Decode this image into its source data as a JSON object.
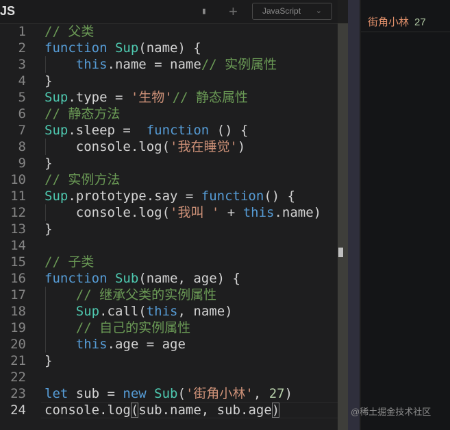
{
  "header": {
    "title": "JS",
    "language": "JavaScript"
  },
  "console": {
    "output_text": "街角小林",
    "output_number": "27"
  },
  "watermark": "@稀土掘金技术社区",
  "current_line": 24,
  "colors": {
    "keyword": "#569cd6",
    "class": "#4ec9b0",
    "string": "#ce9178",
    "comment": "#6a9955",
    "number": "#b5cea8"
  },
  "code": [
    [
      [
        "cm",
        "// 父类"
      ]
    ],
    [
      [
        "kw",
        "function "
      ],
      [
        "cl",
        "Sup"
      ],
      [
        "pl",
        "(name) {"
      ]
    ],
    [
      [
        "pl",
        "    "
      ],
      [
        "kw",
        "this"
      ],
      [
        "pl",
        ".name = name"
      ],
      [
        "cm",
        "// 实例属性"
      ]
    ],
    [
      [
        "pl",
        "}"
      ]
    ],
    [
      [
        "cl",
        "Sup"
      ],
      [
        "pl",
        ".type = "
      ],
      [
        "st",
        "'生物'"
      ],
      [
        "cm",
        "// 静态属性"
      ]
    ],
    [
      [
        "cm",
        "// 静态方法"
      ]
    ],
    [
      [
        "cl",
        "Sup"
      ],
      [
        "pl",
        ".sleep =  "
      ],
      [
        "kw",
        "function"
      ],
      [
        "pl",
        " () {"
      ]
    ],
    [
      [
        "pl",
        "    console.log("
      ],
      [
        "st",
        "'我在睡觉'"
      ],
      [
        "pl",
        ")"
      ]
    ],
    [
      [
        "pl",
        "}"
      ]
    ],
    [
      [
        "cm",
        "// 实例方法"
      ]
    ],
    [
      [
        "cl",
        "Sup"
      ],
      [
        "pl",
        ".prototype.say = "
      ],
      [
        "kw",
        "function"
      ],
      [
        "pl",
        "() {"
      ]
    ],
    [
      [
        "pl",
        "    console.log("
      ],
      [
        "st",
        "'我叫 '"
      ],
      [
        "pl",
        " + "
      ],
      [
        "kw",
        "this"
      ],
      [
        "pl",
        ".name)"
      ]
    ],
    [
      [
        "pl",
        "}"
      ]
    ],
    [],
    [
      [
        "cm",
        "// 子类"
      ]
    ],
    [
      [
        "kw",
        "function "
      ],
      [
        "cl",
        "Sub"
      ],
      [
        "pl",
        "(name, age) {"
      ]
    ],
    [
      [
        "pl",
        "    "
      ],
      [
        "cm",
        "// 继承父类的实例属性"
      ]
    ],
    [
      [
        "pl",
        "    "
      ],
      [
        "cl",
        "Sup"
      ],
      [
        "pl",
        ".call("
      ],
      [
        "kw",
        "this"
      ],
      [
        "pl",
        ", name)"
      ]
    ],
    [
      [
        "pl",
        "    "
      ],
      [
        "cm",
        "// 自己的实例属性"
      ]
    ],
    [
      [
        "pl",
        "    "
      ],
      [
        "kw",
        "this"
      ],
      [
        "pl",
        ".age = age"
      ]
    ],
    [
      [
        "pl",
        "}"
      ]
    ],
    [],
    [
      [
        "kw",
        "let"
      ],
      [
        "pl",
        " sub = "
      ],
      [
        "kw",
        "new "
      ],
      [
        "cl",
        "Sub"
      ],
      [
        "pl",
        "("
      ],
      [
        "st",
        "'街角小林'"
      ],
      [
        "pl",
        ", "
      ],
      [
        "nu",
        "27"
      ],
      [
        "pl",
        ")"
      ]
    ],
    [
      [
        "pl",
        "console.log"
      ],
      [
        "pl",
        "("
      ],
      [
        "pl",
        "sub.name, sub.age"
      ],
      [
        "pl",
        ")"
      ]
    ]
  ]
}
